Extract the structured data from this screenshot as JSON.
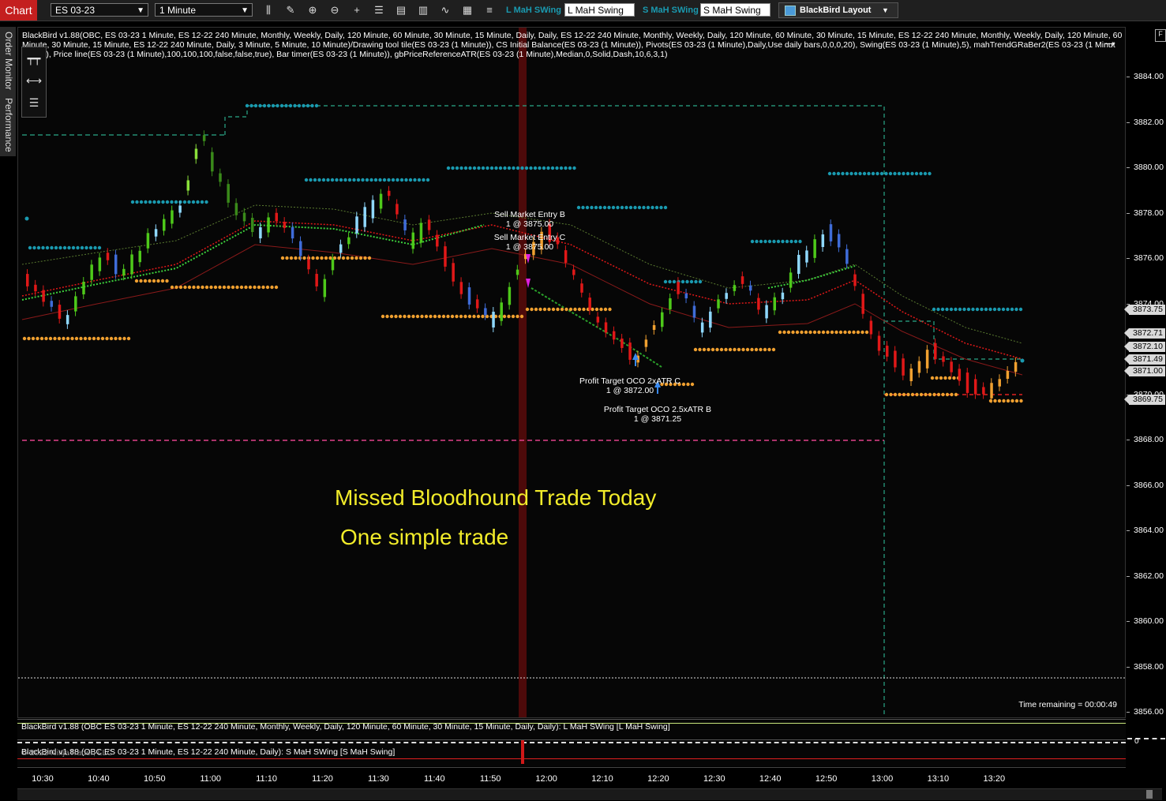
{
  "toolbar": {
    "chart_tab": "Chart",
    "instrument": "ES 03-23",
    "interval": "1 Minute",
    "long_label": "L MaH SWing",
    "long_value": "L MaH Swing",
    "short_label": "S MaH SWing",
    "short_value": "S MaH Swing",
    "layout_label": "BlackBird Layout"
  },
  "side_tabs": [
    "Order Monitor",
    "Performance"
  ],
  "chart": {
    "header_text": "BlackBird v1.88(OBC, ES 03-23 1 Minute, ES 12-22 240 Minute, Monthly, Weekly, Daily, 120 Minute, 60 Minute, 30 Minute, 15 Minute, Daily, Daily, ES 12-22 240 Minute, Monthly, Weekly, Daily, 120 Minute, 60 Minute, 30 Minute, 15 Minute, ES 12-22 240 Minute, Monthly, Weekly, Daily, 120 Minute, 60 Minute, 30 Minute, 15 Minute, ES 12-22 240 Minute, Daily, 3 Minute, 5 Minute, 10 Minute)/Drawing tool tile(ES 03-23 (1 Minute)), CS Initial Balance(ES 03-23 (1 Minute)), Pivots(ES 03-23 (1 Minute),Daily,Use daily bars,0,0,0,20), Swing(ES 03-23 (1 Minute),5), mahTrendGRaBer2(ES 03-23 (1 Minute),true), Price line(ES 03-23 (1 Minute),100,100,100,false,false,true), Bar timer(ES 03-23 (1 Minute)), gbPriceReferenceATR(ES 03-23 (1 Minute),Median,0,Solid,Dash,10,6,3,1)",
    "headline": "Missed Bloodhound Trade Today",
    "subline": "One simple trade",
    "timer": "Time remaining = 00:00:49",
    "annotations": [
      {
        "l1": "Sell Market Entry B",
        "l2": "1 @ 3875.00"
      },
      {
        "l1": "Sell Market Entry C",
        "l2": "1 @ 3875.00"
      },
      {
        "l1": "Profit Target OCO  2xATR C",
        "l2": "1 @ 3872.00"
      },
      {
        "l1": "Profit Target OCO  2.5xATR B",
        "l2": "1 @ 3871.25"
      }
    ]
  },
  "price_axis": {
    "ticks": [
      "3884.00",
      "3882.00",
      "3880.00",
      "3878.00",
      "3876.00",
      "3874.00",
      "3872.00",
      "3870.00",
      "3868.00",
      "3866.00",
      "3864.00",
      "3862.00",
      "3860.00",
      "3858.00",
      "3856.00"
    ],
    "tags": [
      "3873.75",
      "3872.71",
      "3872.10",
      "3871.49",
      "3871.00",
      "3869.75"
    ]
  },
  "panels": {
    "long_text": "BlackBird v1.88 (OBC ES 03-23 1 Minute, ES 12-22 240 Minute, Monthly, Weekly, Daily, 120 Minute, 60 Minute, 30 Minute, 15 Minute, Daily, Daily): L MaH SWing  [L MaH Swing]",
    "short_text": "BlackBird v1.88 (OBC ES 03-23 1 Minute, ES 12-22 240 Minute, Daily): S MaH SWing  [S MaH Swing]",
    "copyright": "© 2022 NinjaTrader, LLC",
    "zero": "0"
  },
  "time_axis": [
    "10:30",
    "10:40",
    "10:50",
    "11:00",
    "11:10",
    "11:20",
    "11:30",
    "11:40",
    "11:50",
    "12:00",
    "12:10",
    "12:20",
    "12:30",
    "12:40",
    "12:50",
    "13:00",
    "13:10",
    "13:20"
  ],
  "colors": {
    "accent": "#c41f1f",
    "teal": "#1a9ab0",
    "yellow_text": "#f2ec2a",
    "bull": "#4ec91a",
    "bear": "#e01818",
    "orange": "#f0a030"
  }
}
